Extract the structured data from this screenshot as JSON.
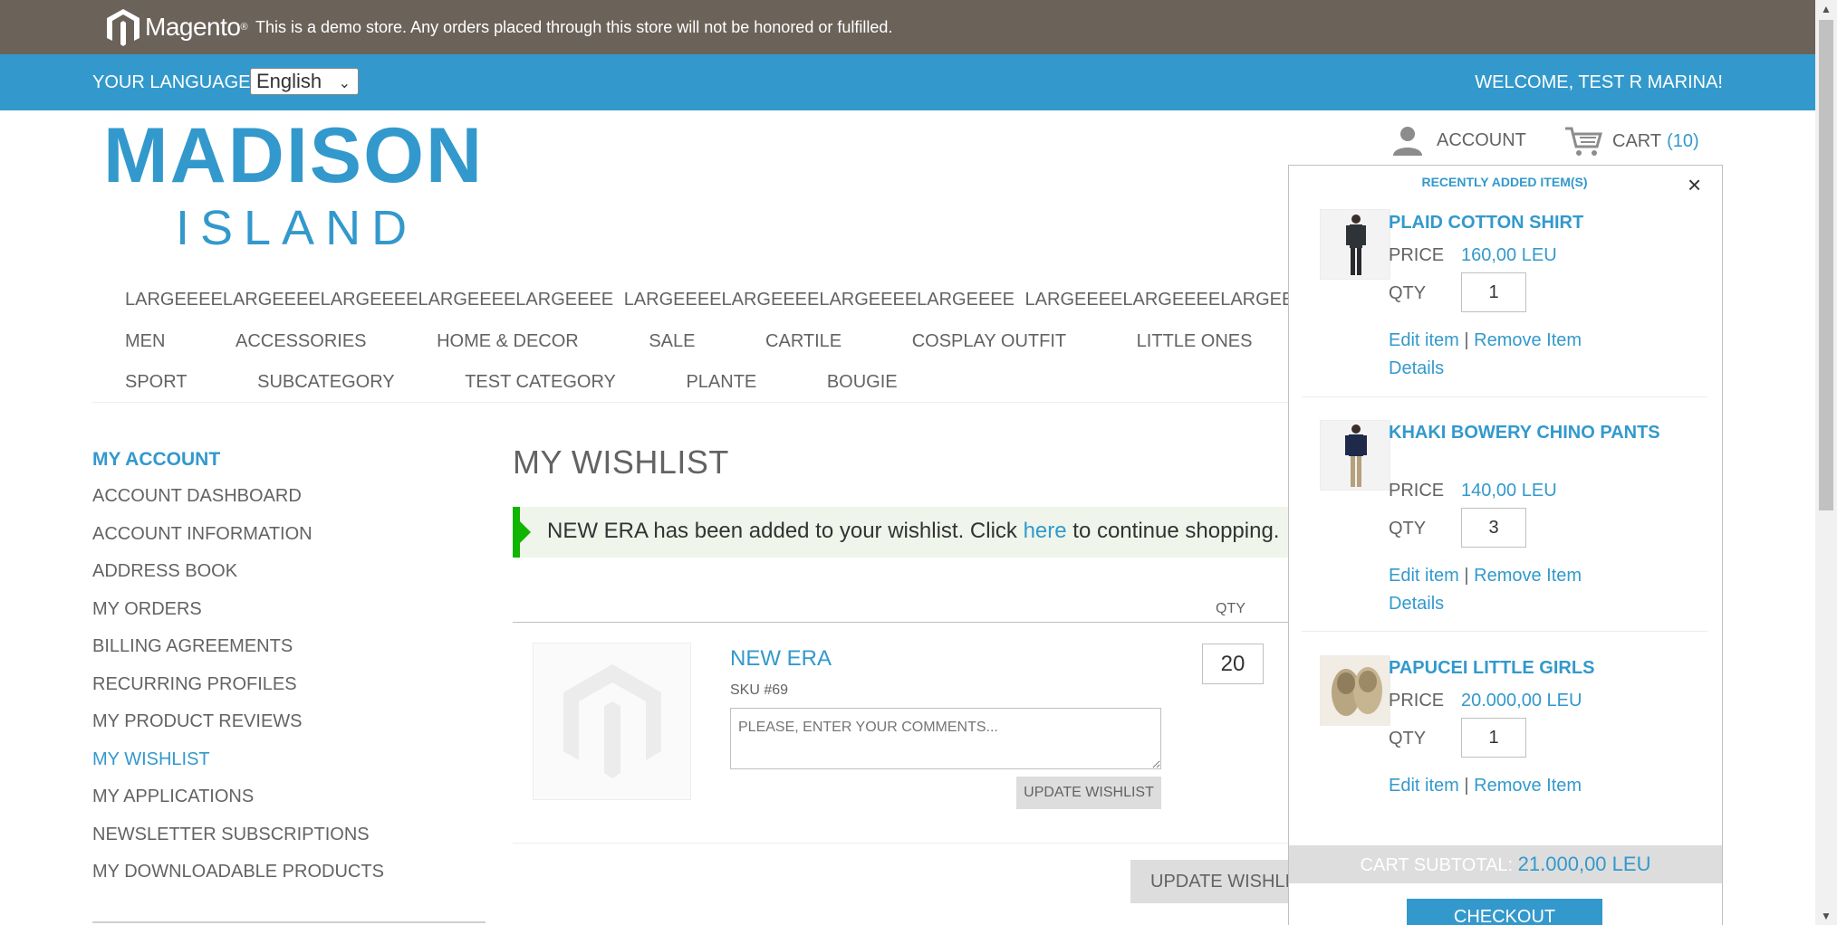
{
  "demo_notice": {
    "brand": "Magento",
    "text": "This is a demo store. Any orders placed through this store will not be honored or fulfilled."
  },
  "language_bar": {
    "label": "YOUR LANGUAGE:",
    "selected": "English",
    "welcome": "WELCOME, TEST R MARINA!"
  },
  "logo": {
    "line1": "MADISON",
    "line2": "ISLAND"
  },
  "header": {
    "account_label": "ACCOUNT",
    "cart_label": "CART",
    "cart_count": "(10)"
  },
  "nav": {
    "row1": [
      "LARGEEEELARGEEEELARGEEEELARGEEEELARGEEEE",
      "LARGEEEELARGEEEELARGEEEELARGEEEE",
      "LARGEEEELARGEEEELARGEEEE"
    ],
    "row2": [
      "MEN",
      "ACCESSORIES",
      "HOME & DECOR",
      "SALE",
      "CARTILE",
      "COSPLAY OUTFIT",
      "LITTLE ONES"
    ],
    "row3": [
      "SPORT",
      "SUBCATEGORY",
      "TEST CATEGORY",
      "PLANTE",
      "BOUGIE"
    ]
  },
  "sidebar": {
    "title": "MY ACCOUNT",
    "items": [
      "ACCOUNT DASHBOARD",
      "ACCOUNT INFORMATION",
      "ADDRESS BOOK",
      "MY ORDERS",
      "BILLING AGREEMENTS",
      "RECURRING PROFILES",
      "MY PRODUCT REVIEWS",
      "MY WISHLIST",
      "MY APPLICATIONS",
      "NEWSLETTER SUBSCRIPTIONS",
      "MY DOWNLOADABLE PRODUCTS"
    ]
  },
  "main": {
    "title": "MY WISHLIST",
    "message_before": "NEW ERA has been added to your wishlist. Click ",
    "message_link": "here",
    "message_after": " to continue shopping.",
    "qty_header": "QTY",
    "item": {
      "name": "NEW ERA",
      "sku": "SKU #69",
      "comment_placeholder": "PLEASE, ENTER YOUR COMMENTS...",
      "qty": "20",
      "update_label": "UPDATE WISHLIST"
    },
    "update_all_label": "UPDATE WISHLIST"
  },
  "minicart": {
    "title": "RECENTLY ADDED ITEM(S)",
    "close": "×",
    "price_label": "PRICE",
    "qty_label": "QTY",
    "edit_label": "Edit item",
    "link_sep": "|",
    "remove_label": "Remove Item",
    "details_label": "Details",
    "items": [
      {
        "name": "PLAID COTTON SHIRT",
        "price": "160,00 LEU",
        "qty": "1"
      },
      {
        "name": "KHAKI BOWERY CHINO PANTS",
        "price": "140,00 LEU",
        "qty": "3"
      },
      {
        "name": "PAPUCEI LITTLE GIRLS",
        "price": "20.000,00 LEU",
        "qty": "1"
      }
    ],
    "subtotal_label": "CART SUBTOTAL:",
    "subtotal_value": "21.000,00 LEU",
    "checkout_label": "CHECKOUT"
  },
  "colors": {
    "accent": "#3399cc",
    "demo_bar": "#6b6259",
    "success": "#11b400"
  }
}
